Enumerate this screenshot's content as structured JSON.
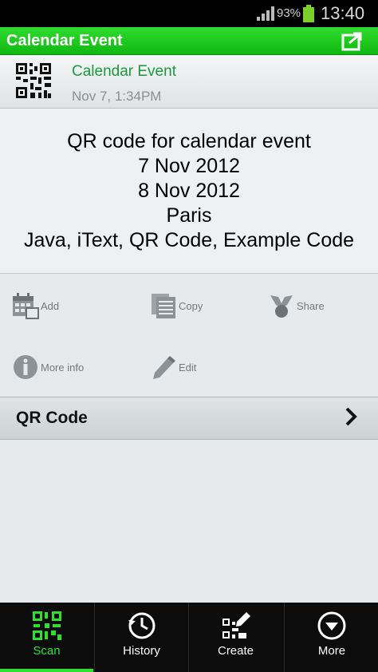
{
  "status_bar": {
    "battery_percent": "93%",
    "time": "13:40"
  },
  "title_bar": {
    "title": "Calendar Event"
  },
  "event_header": {
    "type": "Calendar Event",
    "timestamp": "Nov 7, 1:34PM"
  },
  "content": {
    "lines": [
      "QR code for calendar event",
      "7 Nov 2012",
      "8 Nov 2012",
      "Paris",
      "Java, iText, QR Code, Example Code"
    ]
  },
  "actions": {
    "add": "Add",
    "copy": "Copy",
    "share": "Share",
    "more_info": "More info",
    "edit": "Edit"
  },
  "qr_row": {
    "label": "QR Code"
  },
  "bottom_nav": {
    "scan": "Scan",
    "history": "History",
    "create": "Create",
    "more": "More"
  },
  "colors": {
    "accent": "#2fe02f",
    "title_green": "#1a9a3a"
  }
}
